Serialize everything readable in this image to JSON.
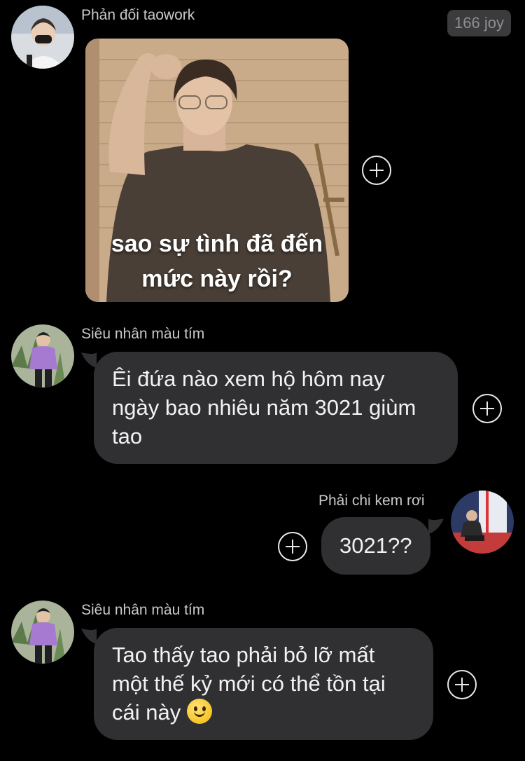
{
  "messages": [
    {
      "sender": "Phản đối taowork",
      "badge": "166 joy",
      "meme_caption_line1": "sao sự tình đã đến",
      "meme_caption_line2": "mức này rồi?"
    },
    {
      "sender": "Siêu nhân màu tím",
      "text_line1": "Êi đứa nào xem hộ hôm nay",
      "text_line2": "ngày bao nhiêu năm 3021 giùm",
      "text_line3": "tao"
    },
    {
      "sender": "Phải chi kem rơi",
      "text": "3021??"
    },
    {
      "sender": "Siêu nhân màu tím",
      "text_line1": "Tao thấy tao phải bỏ lỡ mất",
      "text_line2": "một thế kỷ mới có thể tồn tại",
      "text_line3": "cái này",
      "emoji": "slightly-smiling-face-icon"
    }
  ],
  "icons": {
    "add_reaction": "plus-circle-icon"
  },
  "colors": {
    "background": "#000000",
    "bubble": "#303033",
    "sender_name": "#c9c9cc",
    "badge_bg": "#3b3b3d"
  }
}
